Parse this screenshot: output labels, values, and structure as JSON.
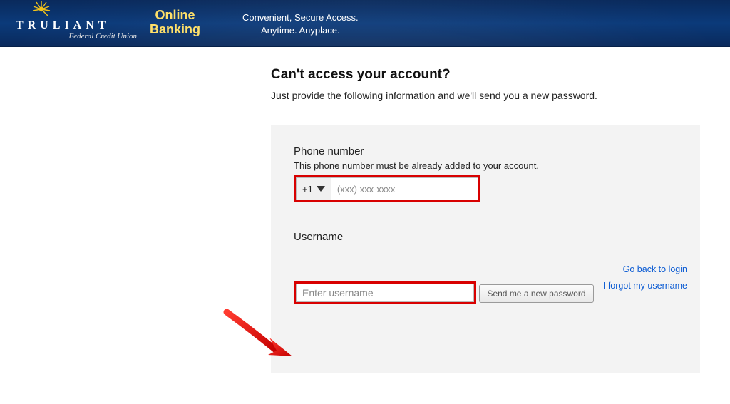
{
  "header": {
    "brand_main": "TRULIANT",
    "brand_sub": "Federal Credit Union",
    "online_banking_line1": "Online",
    "online_banking_line2": "Banking",
    "tagline_line1": "Convenient, Secure Access.",
    "tagline_line2": "Anytime. Anyplace."
  },
  "page": {
    "title": "Can't access your account?",
    "subtitle": "Just provide the following information and we'll send you a new password."
  },
  "form": {
    "phone_label": "Phone number",
    "phone_help": "This phone number must be already added to your account.",
    "country_code": "+1",
    "phone_placeholder": "(xxx) xxx-xxxx",
    "username_label": "Username",
    "username_placeholder": "Enter username",
    "submit_label": "Send me a new password"
  },
  "links": {
    "back": "Go back to login",
    "forgot_username": "I forgot my username"
  }
}
